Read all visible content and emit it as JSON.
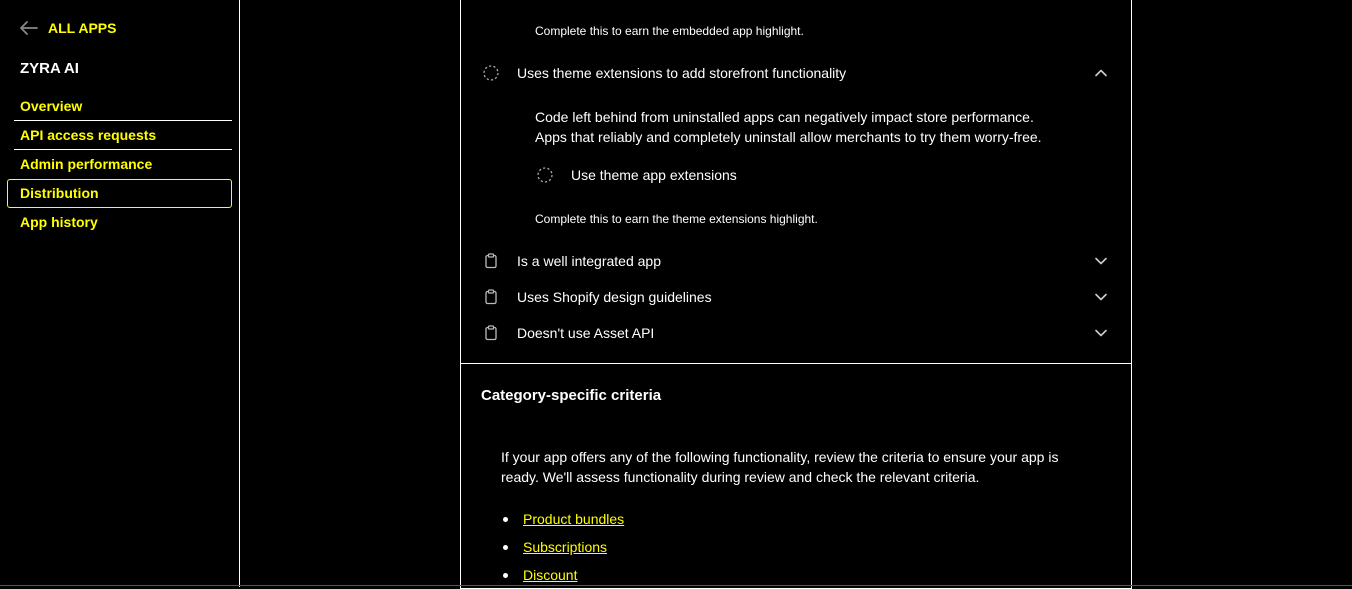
{
  "sidebar": {
    "back_label": "ALL APPS",
    "app_name": "ZYRA AI",
    "items": [
      {
        "label": "Overview"
      },
      {
        "label": "API access requests"
      },
      {
        "label": "Admin performance"
      },
      {
        "label": "Distribution"
      },
      {
        "label": "App history"
      }
    ],
    "active_item": "Distribution"
  },
  "main": {
    "embedded_note": "Complete this to earn the embedded app highlight.",
    "theme_row": {
      "label": "Uses theme extensions to add storefront functionality",
      "icon": "dashed-circle-icon",
      "expanded": true
    },
    "theme_desc_1": "Code left behind from uninstalled apps can negatively impact store performance.",
    "theme_desc_2": "Apps that reliably and completely uninstall allow merchants to try them worry-free.",
    "theme_sub": {
      "label": "Use theme app extensions",
      "icon": "dashed-circle-icon"
    },
    "theme_note": "Complete this to earn the theme extensions highlight.",
    "rows": [
      {
        "label": "Is a well integrated app",
        "icon": "clipboard-icon"
      },
      {
        "label": "Uses Shopify design guidelines",
        "icon": "clipboard-icon"
      },
      {
        "label": "Doesn't use Asset API",
        "icon": "clipboard-icon"
      }
    ],
    "category": {
      "title": "Category-specific criteria",
      "desc": "If your app offers any of the following functionality, review the criteria to ensure your app is ready. We'll assess functionality during review and check the relevant criteria.",
      "links": [
        "Product bundles",
        "Subscriptions",
        "Discount"
      ]
    }
  },
  "colors": {
    "accent": "#ffff00",
    "background": "#000000",
    "text": "#ffffff"
  }
}
